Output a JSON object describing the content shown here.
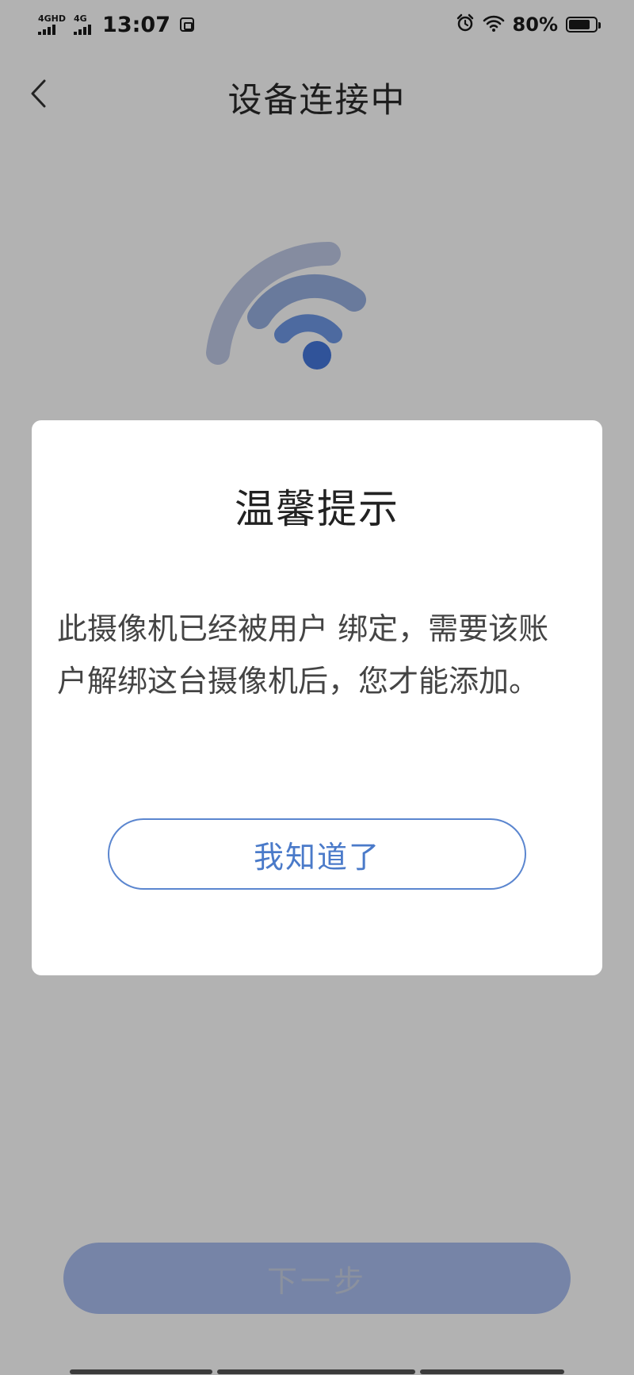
{
  "status_bar": {
    "network1": "4GHD",
    "network2": "4G",
    "time": "13:07",
    "battery": "80%",
    "icons": [
      "signal-icon",
      "vpn-icon",
      "alarm-icon",
      "wifi-icon",
      "battery-icon"
    ],
    "battery_level": 0.8
  },
  "header": {
    "title": "设备连接中",
    "back_icon": "chevron-left-icon"
  },
  "graphic": {
    "icon": "wifi-icon",
    "colors": [
      "#bfc9e6",
      "#97afe0",
      "#6f98e6",
      "#4577dc"
    ]
  },
  "dialog": {
    "title": "温馨提示",
    "message": "此摄像机已经被用户 绑定，需要该账户解绑这台摄像机后，您才能添加。",
    "button": "我知道了"
  },
  "footer": {
    "next_button": "下一步"
  },
  "colors": {
    "accent": "#4a7ac9",
    "button_disabled": "#a9bdf0",
    "overlay": "rgba(0,0,0,0.30)"
  }
}
